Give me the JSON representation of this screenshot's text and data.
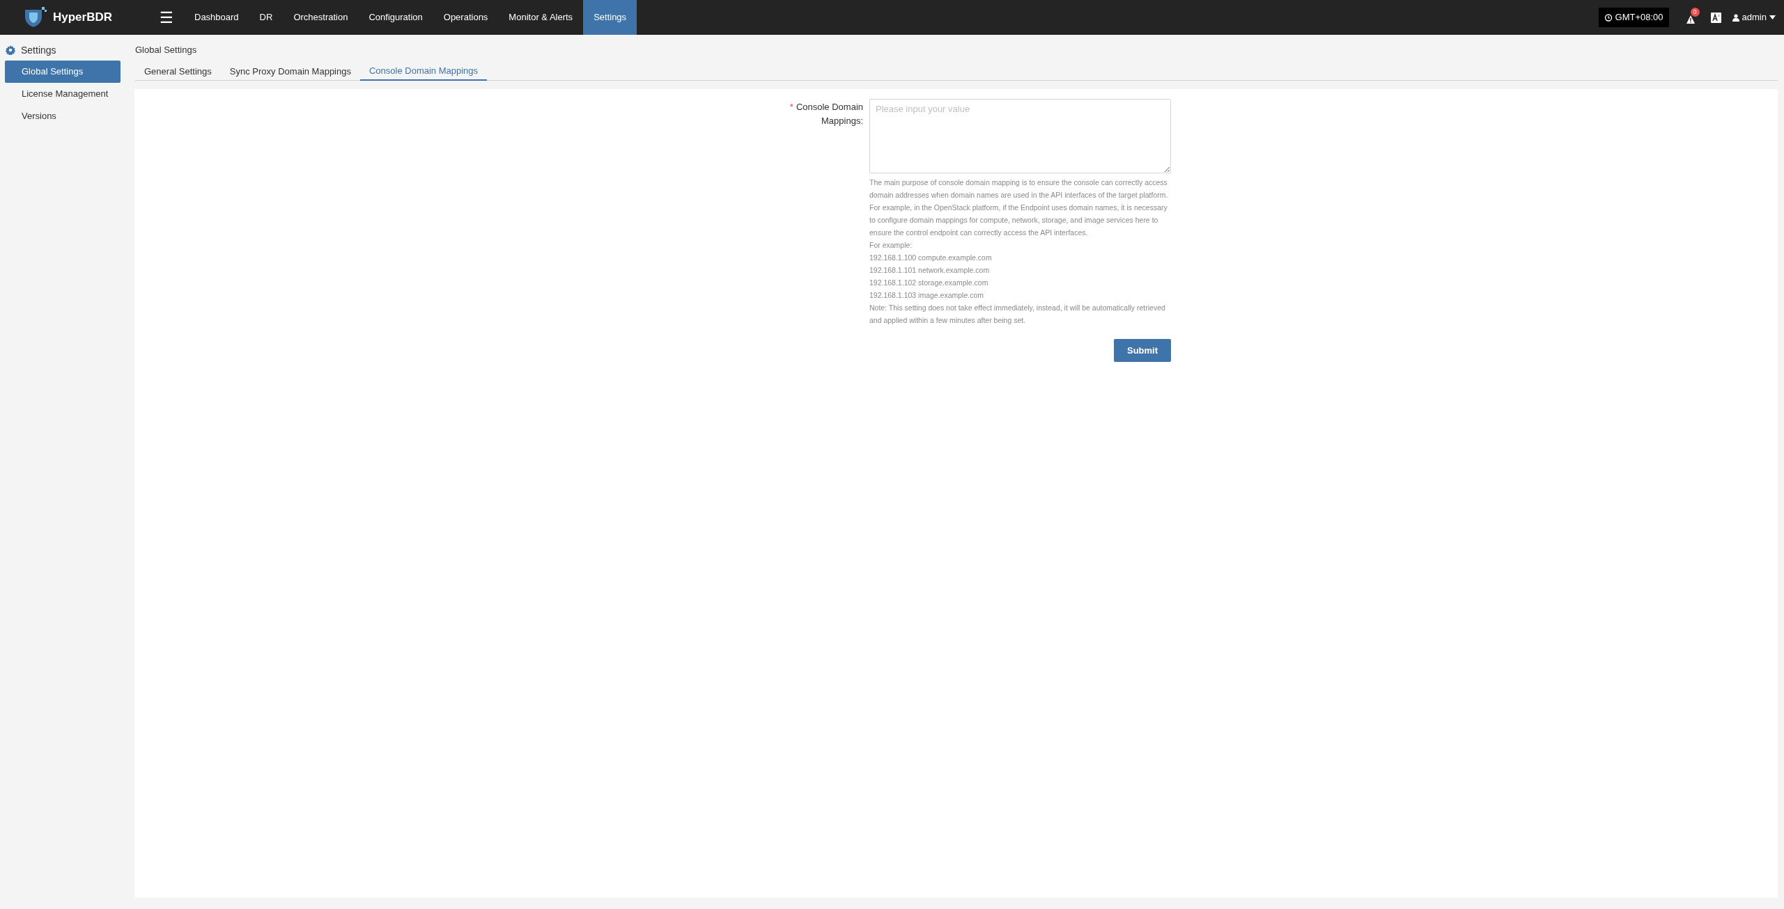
{
  "header": {
    "brand": "HyperBDR",
    "menu_icon": "☰",
    "nav": [
      {
        "label": "Dashboard",
        "selected": false
      },
      {
        "label": "DR",
        "selected": false
      },
      {
        "label": "Orchestration",
        "selected": false
      },
      {
        "label": "Configuration",
        "selected": false
      },
      {
        "label": "Operations",
        "selected": false
      },
      {
        "label": "Monitor & Alerts",
        "selected": false
      },
      {
        "label": "Settings",
        "selected": true
      }
    ],
    "timezone": "GMT+08:00",
    "alert_count": "0",
    "user": "admin"
  },
  "sidebar": {
    "title": "Settings",
    "items": [
      {
        "label": "Global Settings",
        "selected": true
      },
      {
        "label": "License Management",
        "selected": false
      },
      {
        "label": "Versions",
        "selected": false
      }
    ]
  },
  "page_title": "Global Settings",
  "tabs": [
    {
      "label": "General Settings",
      "selected": false
    },
    {
      "label": "Sync Proxy Domain Mappings",
      "selected": false
    },
    {
      "label": "Console Domain Mappings",
      "selected": true
    }
  ],
  "form": {
    "label": "Console Domain Mappings:",
    "required": true,
    "required_mark": "*",
    "placeholder": "Please input your value",
    "help": [
      "The main purpose of console domain mapping is to ensure the console can correctly access domain addresses when domain names are used in the API interfaces of the target platform. For example, in the OpenStack platform, if the Endpoint uses domain names, it is necessary to configure domain mappings for compute, network, storage, and image services here to ensure the control endpoint can correctly access the API interfaces.",
      "For example:",
      "192.168.1.100 compute.example.com",
      "192.168.1.101 network.example.com",
      "192.168.1.102 storage.example.com",
      "192.168.1.103 image.example.com",
      "Note: This setting does not take effect immediately, instead, it will be automatically retrieved and applied within a few minutes after being set."
    ],
    "submit": "Submit"
  }
}
